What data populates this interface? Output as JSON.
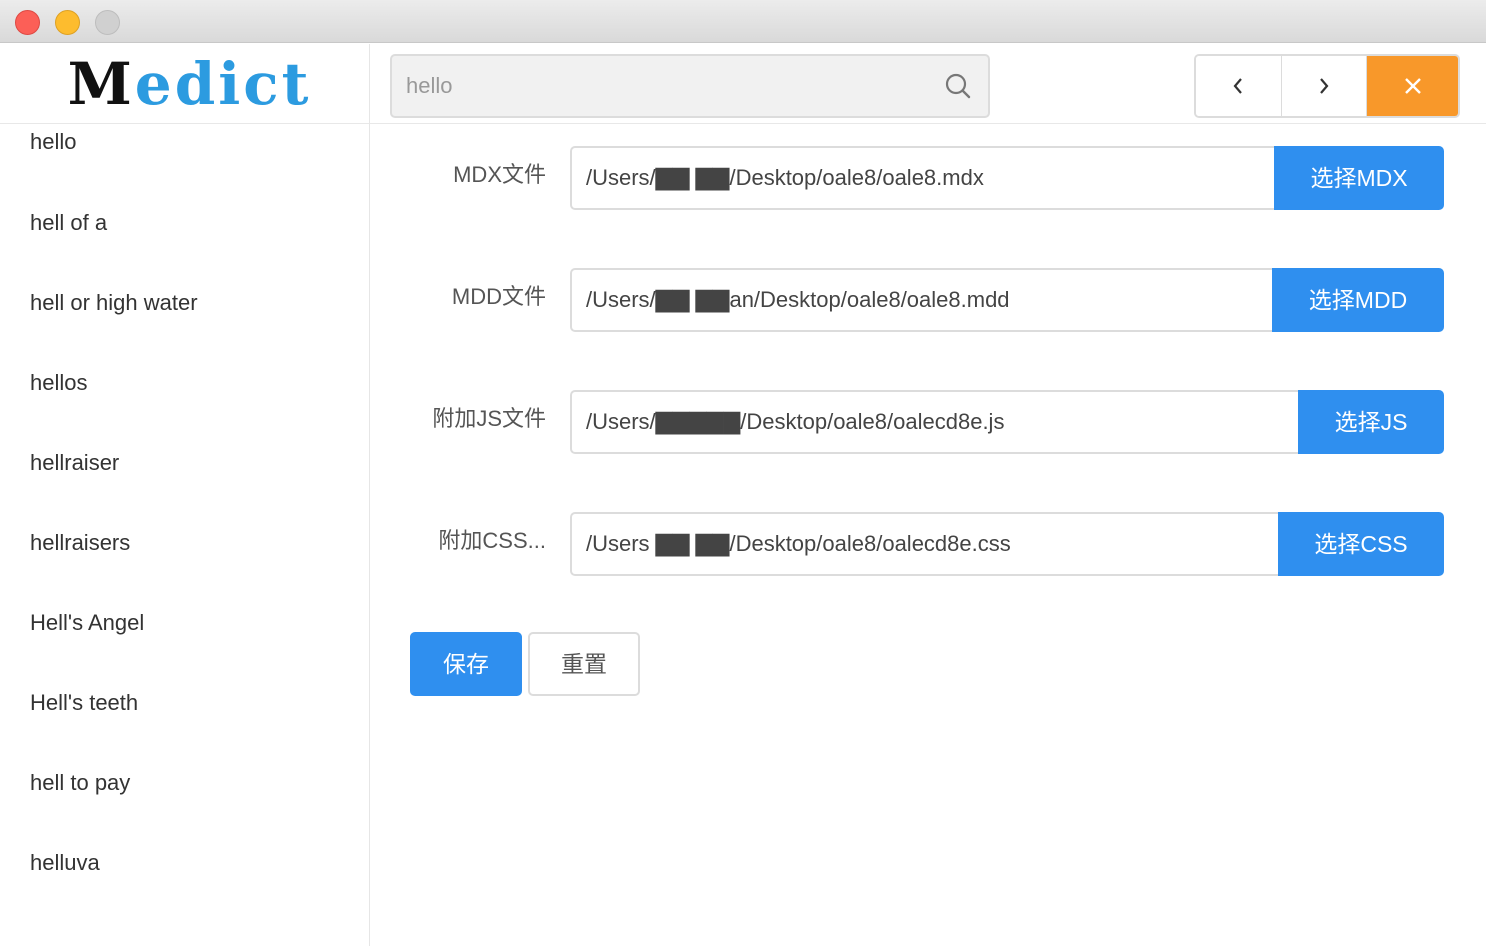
{
  "sidebar": {
    "logo": {
      "first_letter": "M",
      "rest": "edict"
    },
    "words": [
      "hello",
      "hell of a",
      "hell or high water",
      "hellos",
      "hellraiser",
      "hellraisers",
      "Hell's Angel",
      "Hell's teeth",
      "hell to pay",
      "helluva"
    ]
  },
  "search": {
    "value": "hello",
    "icon": "search-icon"
  },
  "nav": {
    "back_icon": "chevron-left-icon",
    "forward_icon": "chevron-right-icon",
    "close_icon": "close-icon",
    "close_color": "#f8982a"
  },
  "form": {
    "mdx": {
      "label": "MDX文件",
      "path": "/Users/▇▇ ▇▇/Desktop/oale8/oale8.mdx",
      "button": "选择MDX"
    },
    "mdd": {
      "label": "MDD文件",
      "path": "/Users/▇▇ ▇▇an/Desktop/oale8/oale8.mdd",
      "button": "选择MDD"
    },
    "js": {
      "label": "附加JS文件",
      "path": "/Users/▇▇▇▇▇/Desktop/oale8/oalecd8e.js",
      "button": "选择JS"
    },
    "css": {
      "label": "附加CSS...",
      "path": "/Users ▇▇ ▇▇/Desktop/oale8/oalecd8e.css",
      "button": "选择CSS"
    },
    "save_label": "保存",
    "reset_label": "重置"
  },
  "colors": {
    "primary": "#2f8fef",
    "accent": "#f8982a",
    "logo_blue": "#2c9be0"
  }
}
